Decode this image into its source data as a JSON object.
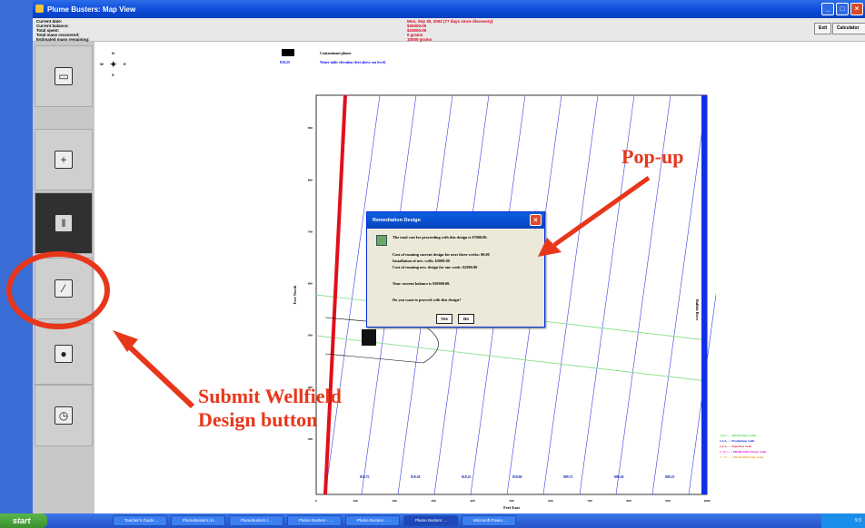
{
  "window": {
    "title": "Plume Busters: Map View"
  },
  "info": {
    "labels": [
      "Current date:",
      "Current balance:",
      "Total spent:",
      "Total mass recovered:",
      "Estimated mass remaining:"
    ],
    "values": [
      "Mon, Sep 30, 2002 (77 days since discovery)",
      "$30000.00",
      "$15000.00",
      "0 grams",
      "10000 grams"
    ]
  },
  "toolbar": {
    "exit_label": "Exit",
    "calculator_label": "Calculator"
  },
  "compass": {
    "n": "N",
    "s": "S",
    "e": "E",
    "w": "W"
  },
  "legend_top": {
    "plume": "Contaminant plume",
    "contour_value": "818.25",
    "contour_label": "Water table elevation (feet above sea level)"
  },
  "chart_data": {
    "type": "contour-map",
    "xlabel": "Feet East",
    "ylabel": "Feet North",
    "xlim": [
      0,
      1000
    ],
    "ylim": [
      0,
      1000
    ],
    "xticks": [
      "0",
      "100",
      "200",
      "300",
      "400",
      "500",
      "600",
      "700",
      "800",
      "900",
      "1000"
    ],
    "yticks": [
      "300",
      "400",
      "500",
      "600",
      "700",
      "800",
      "900",
      "1000"
    ],
    "contour_labels": [
      "818.75",
      "818.50",
      "818.25",
      "818.00",
      "809.75",
      "809.50",
      "809.25"
    ],
    "river_label": "Buffalo River",
    "legend": [
      {
        "text": "1,2,3,... : Observation wells",
        "color": "#3ad13a"
      },
      {
        "text": "1,2,3,... : Production wells",
        "color": "#0018d0"
      },
      {
        "text": "1,2,3,... : Injection wells",
        "color": "#d0203a"
      },
      {
        "text": "1\",2\",... : PROPOSED Prod. wells",
        "color": "#d800d8"
      },
      {
        "text": "1\",2\",... : PROPOSED Inj. wells",
        "color": "#e8a020"
      }
    ]
  },
  "dialog": {
    "title": "Remediation Design",
    "lines": [
      "The total cost for proceeding with this design is $7000.00.",
      "Cost of running current design for next three weeks: $0.00",
      "Installation of new wells: $5000.00",
      "Cost of running new design for one week: $2000.00",
      "Your current balance is $30000.00.",
      "Do you want to proceed with this design?"
    ],
    "yes_label": "Yes",
    "no_label": "No"
  },
  "annotations": {
    "popup": "Pop-up",
    "submit_line1": "Submit Wellfield",
    "submit_line2": "Design button",
    "color": "#e8361b"
  },
  "taskbar": {
    "start": "start",
    "items": [
      "Teacher's Guide ...",
      "PlumeBusters (H...",
      "Plumebusters (...",
      "Plume Busters - ...",
      "Plume Busters - ...",
      "Plume Busters: ...",
      "Microsoft Power..."
    ],
    "clock": "9:3"
  }
}
